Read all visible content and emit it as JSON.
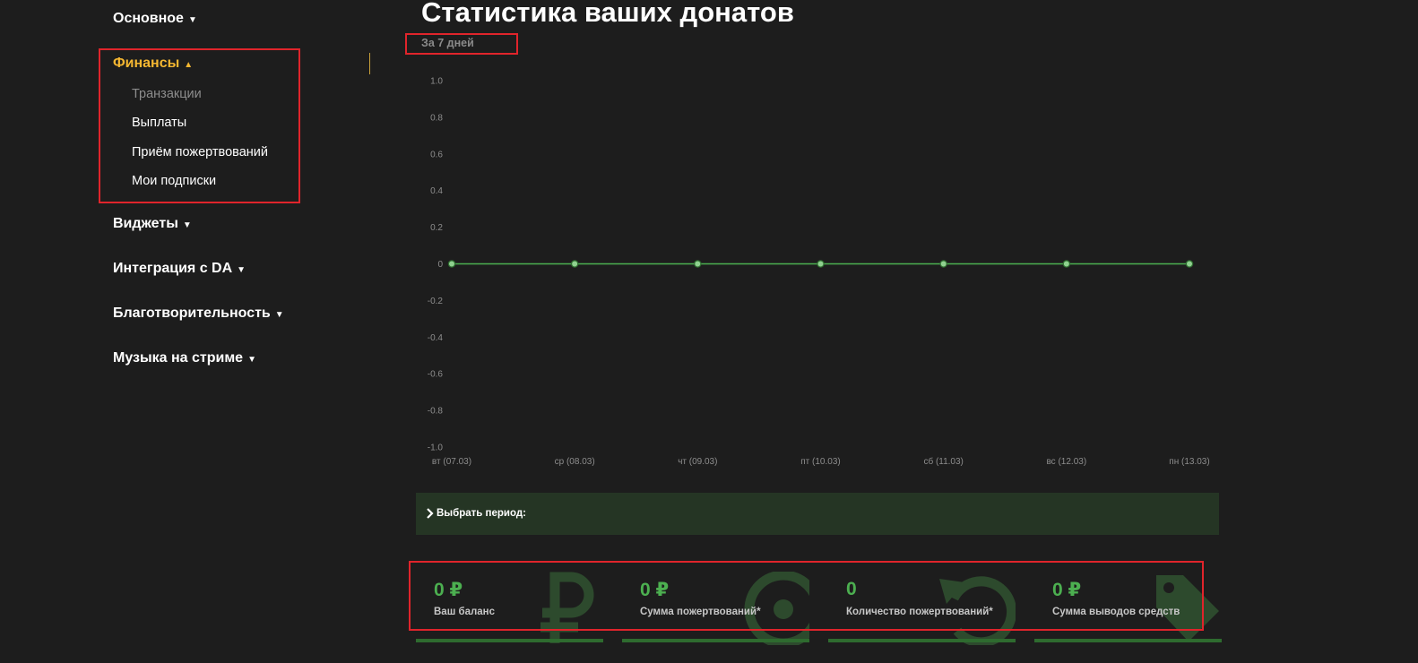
{
  "sidebar": {
    "groups": [
      {
        "label": "Основное",
        "caret": "▼"
      },
      {
        "label": "Финансы",
        "caret": "▲"
      },
      {
        "label": "Виджеты",
        "caret": "▼"
      },
      {
        "label": "Интеграция с DA",
        "caret": "▼"
      },
      {
        "label": "Благотворительность",
        "caret": "▼"
      },
      {
        "label": "Музыка на стриме",
        "caret": "▼"
      }
    ],
    "finance_items": [
      {
        "label": "Транзакции"
      },
      {
        "label": "Выплаты"
      },
      {
        "label": "Приём пожертвований"
      },
      {
        "label": "Мои подписки"
      }
    ]
  },
  "main": {
    "title": "Статистика ваших донатов",
    "period_label": "За 7 дней",
    "period_selector_label": "Выбрать период:"
  },
  "chart_data": {
    "type": "line",
    "categories": [
      "вт (07.03)",
      "ср (08.03)",
      "чт (09.03)",
      "пт (10.03)",
      "сб (11.03)",
      "вс (12.03)",
      "пн (13.03)"
    ],
    "series": [
      {
        "values": [
          0,
          0,
          0,
          0,
          0,
          0,
          0
        ]
      }
    ],
    "yticks": [
      "1.0",
      "0.8",
      "0.6",
      "0.4",
      "0.2",
      "0",
      "-0.2",
      "-0.4",
      "-0.6",
      "-0.8",
      "-1.0"
    ],
    "ylim": [
      -1,
      1
    ],
    "grid": false,
    "colors": {
      "line": "#4caf50",
      "point_fill": "#8fd18f",
      "point_stroke": "#2f6d30"
    }
  },
  "stats": [
    {
      "value": "0 ₽",
      "label": "Ваш баланс",
      "icon": "ruble-icon"
    },
    {
      "value": "0 ₽",
      "label": "Сумма пожертвований*",
      "icon": "target-icon"
    },
    {
      "value": "0",
      "label": "Количество пожертвований*",
      "icon": "refresh-icon"
    },
    {
      "value": "0 ₽",
      "label": "Сумма выводов средств",
      "icon": "tag-icon"
    }
  ],
  "colors": {
    "background": "#1d1d1d",
    "accent": "#f5b731",
    "green": "#4caf50",
    "highlight": "#e0242b"
  }
}
